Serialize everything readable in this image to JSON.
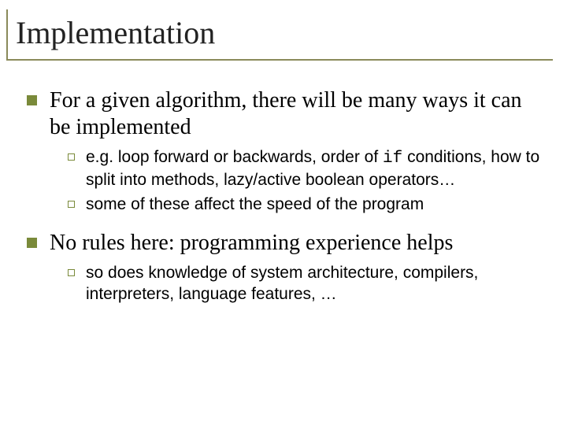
{
  "title": "Implementation",
  "items": [
    {
      "text": "For a given algorithm, there will be many ways it can be implemented",
      "sub": [
        {
          "prefix": "e.g. loop forward or backwards, order of ",
          "code": "if",
          "suffix": " conditions, how to split into methods, lazy/active boolean operators…"
        },
        {
          "prefix": "some of these affect the speed of the program",
          "code": "",
          "suffix": ""
        }
      ]
    },
    {
      "text": "No rules here: programming experience helps",
      "sub": [
        {
          "prefix": "so does knowledge of system architecture, compilers, interpreters, language features, …",
          "code": "",
          "suffix": ""
        }
      ]
    }
  ]
}
